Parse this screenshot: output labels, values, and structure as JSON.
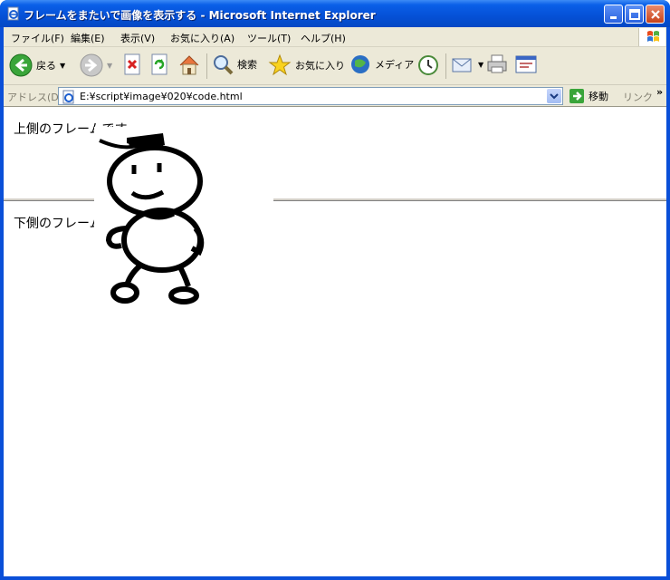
{
  "window": {
    "title": "フレームをまたいで画像を表示する - Microsoft Internet Explorer"
  },
  "menu": [
    "ファイル(F)",
    "編集(E)",
    "表示(V)",
    "お気に入り(A)",
    "ツール(T)",
    "ヘルプ(H)"
  ],
  "toolbar": {
    "back_label": "戻る",
    "search_label": "検索",
    "favorites_label": "お気に入り",
    "media_label": "メディア"
  },
  "address": {
    "label": "アドレス(D)",
    "url": "E:¥script¥image¥020¥code.html",
    "go_label": "移動",
    "links_label": "リンク",
    "more": "»"
  },
  "frames": {
    "top_text": "上側のフレームです",
    "bottom_text": "下側のフレームです"
  },
  "colors": {
    "titlebar": "#0550d6",
    "chrome": "#ece9d8",
    "page_bg": "#ffffff"
  },
  "icons": [
    "ie-page-icon",
    "minimize-icon",
    "maximize-icon",
    "close-icon",
    "back-arrow-icon",
    "forward-arrow-icon",
    "stop-icon",
    "refresh-icon",
    "home-icon",
    "search-icon",
    "favorites-star-icon",
    "media-icon",
    "history-icon",
    "mail-icon",
    "print-icon",
    "edit-icon",
    "go-arrow-icon",
    "windows-flag-icon"
  ]
}
